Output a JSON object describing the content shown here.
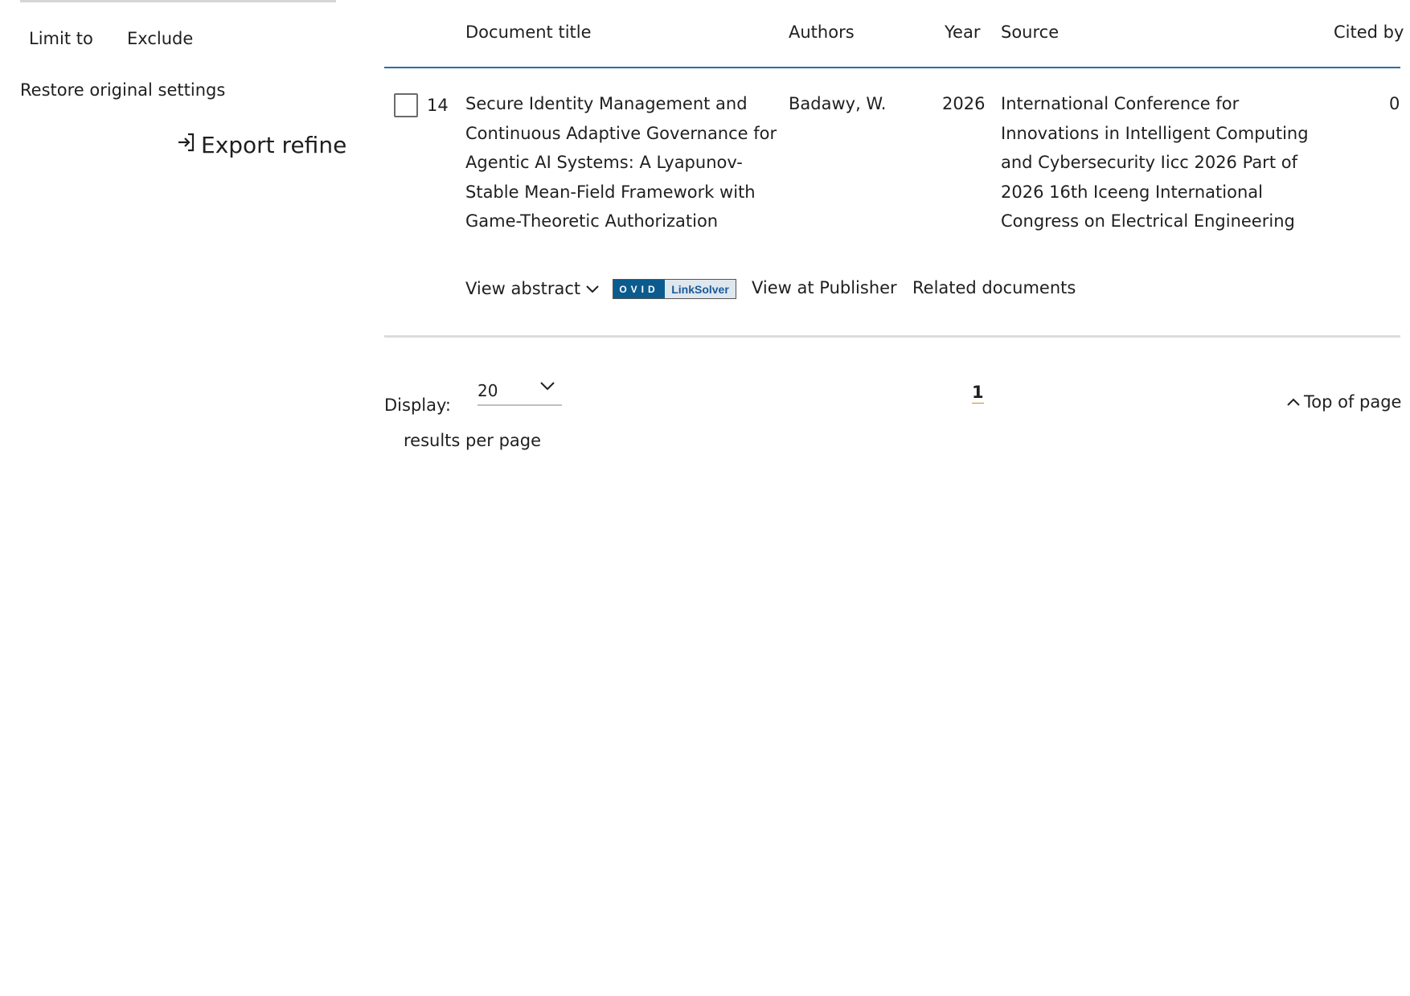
{
  "sidebar": {
    "limit_to": "Limit to",
    "exclude": "Exclude",
    "restore": "Restore original settings",
    "export_refine": "Export refine",
    "export_icon": "sign-in-arrow-icon"
  },
  "table": {
    "headers": {
      "document_title": "Document title",
      "authors": "Authors",
      "year": "Year",
      "source": "Source",
      "cited_by": "Cited by"
    },
    "rows": [
      {
        "number": "14",
        "title_lines": [
          "Secure Identity Management and",
          "Continuous Adaptive Governance for",
          "Agentic AI Systems: A Lyapunov-",
          "Stable Mean-Field Framework with",
          "Game-Theoretic Authorization"
        ],
        "authors": "Badawy, W.",
        "year": "2026",
        "source_lines": [
          "International Conference for",
          "Innovations in Intelligent Computing",
          "and Cybersecurity Iicc 2026 Part of",
          "2026 16th Iceeng International",
          "Congress on Electrical Engineering"
        ],
        "cited_by": "0",
        "actions": {
          "view_abstract": "View abstract",
          "linksolver_ovid": "OVID",
          "linksolver_label": "LinkSolver",
          "view_at_publisher": "View at Publisher",
          "related_documents": "Related documents"
        }
      }
    ]
  },
  "footer": {
    "display_label": "Display:",
    "display_value": "20",
    "results_per_page": "results per page",
    "current_page": "1",
    "top_of_page": "Top of page"
  },
  "colors": {
    "header_rule": "#2b6cb0",
    "ovid_blue": "#0b5b8f",
    "page_underline": "#d08a20"
  }
}
